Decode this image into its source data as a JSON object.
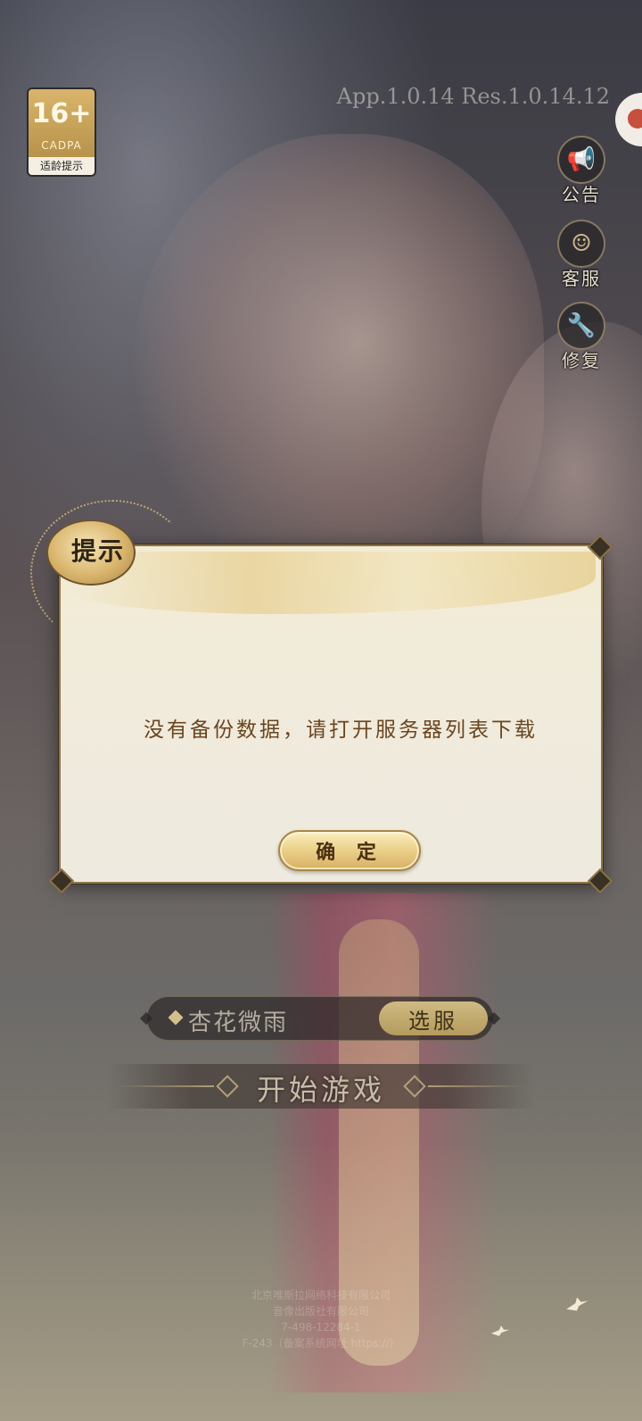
{
  "age_badge": {
    "rating": "16+",
    "org": "CADPA",
    "label": "适龄提示"
  },
  "version_text": "App.1.0.14 Res.1.0.14.12",
  "side_buttons": [
    {
      "icon": "megaphone-icon",
      "label": "公告"
    },
    {
      "icon": "headset-icon",
      "label": "客服"
    },
    {
      "icon": "wrench-icon",
      "label": "修复"
    }
  ],
  "dialog": {
    "title": "提示",
    "message": "没有备份数据，请打开服务器列表下载",
    "confirm_label": "确 定"
  },
  "server": {
    "name": "杏花微雨",
    "select_label": "选服"
  },
  "start_label": "开始游戏",
  "footer_lines": [
    "北京唯斯拉网络科技有限公司",
    "音像出版社有限公司",
    "7-498-12284-1",
    "F-243（备案系统网址 https://）"
  ],
  "colors": {
    "dialog_bg": "#f1ebda",
    "dialog_border": "#8d7447",
    "message_text": "#6a4520",
    "button_gold": "#ecd28d"
  }
}
